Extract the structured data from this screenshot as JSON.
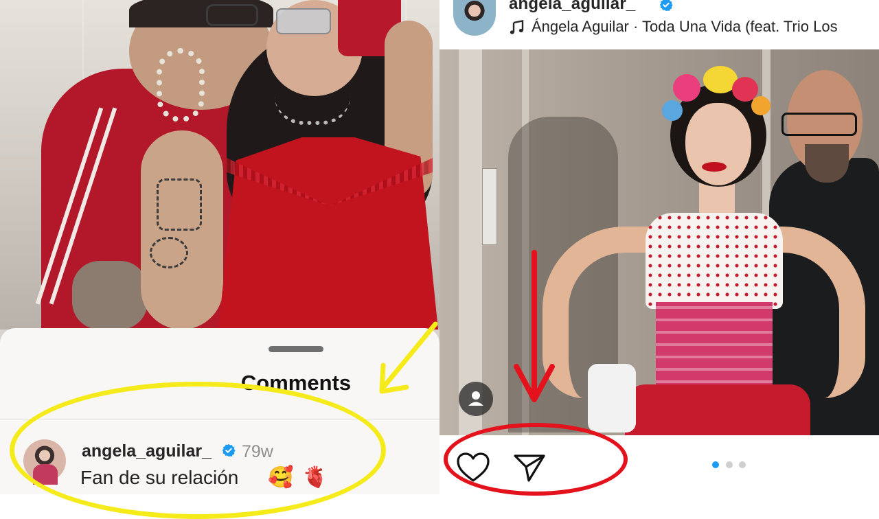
{
  "left_panel": {
    "sheet": {
      "title": "Comments",
      "comment": {
        "username": "angela_aguilar_",
        "verified": true,
        "time": "79w",
        "text": "Fan de su relación",
        "emojis": [
          "🥰",
          "🫀"
        ]
      }
    },
    "annotation_color": "#f6eb1a"
  },
  "right_panel": {
    "header": {
      "username": "angela_aguilar_",
      "verified": true,
      "music": "Ángela Aguilar · Toda Una Vida (feat. Trio Los"
    },
    "post": {
      "carousel": {
        "total": 3,
        "active": 1
      }
    },
    "annotation_color": "#e3121c",
    "verified_color": "#1d9bf0"
  }
}
